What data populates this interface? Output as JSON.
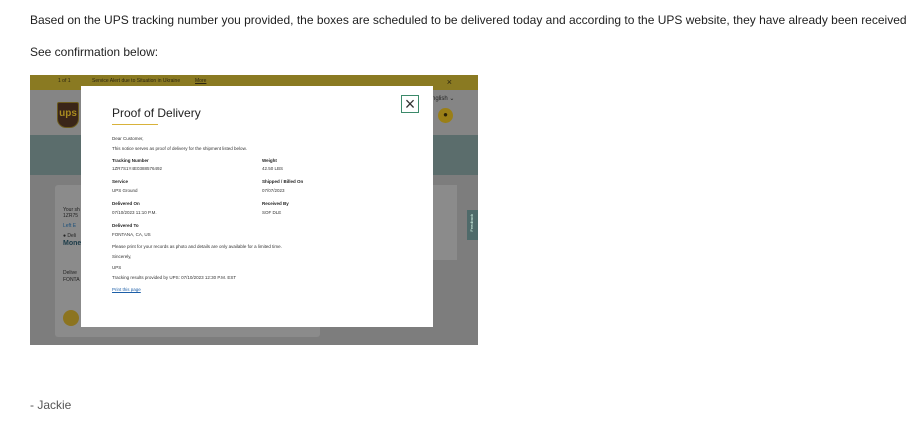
{
  "message": {
    "line1": "Based on the UPS tracking number you provided, the boxes are scheduled to be delivered today and according to the UPS website, they have already been received.",
    "line2": "See confirmation below:",
    "signature": "- Jackie"
  },
  "screenshot": {
    "alert": {
      "count": "1 of 1",
      "text": "Service Alert due to Situation in Ukraine",
      "more": "More",
      "close": "×"
    },
    "header": {
      "logo": "ups",
      "lang": "nglish ⌄"
    },
    "card": {
      "l1": "Your sh",
      "l2": "1ZR75",
      "l3": "Left E",
      "l4": "● Deli",
      "l5": "Mone",
      "l6": "Delive",
      "l7": "FONTA"
    },
    "feedback": "Feedback",
    "modal": {
      "title": "Proof of Delivery",
      "close": "×",
      "greeting": "Dear Customer,",
      "intro": "This notice serves as proof of delivery for the shipment listed below.",
      "tracking_label": "Tracking Number",
      "tracking_value": "1ZR7S1Y4E0388576492",
      "weight_label": "Weight",
      "weight_value": "42.50 LBS",
      "service_label": "Service",
      "service_value": "UPS Ground",
      "shipped_label": "Shipped / Billed On",
      "shipped_value": "07/07/2023",
      "delivered_on_label": "Delivered On",
      "delivered_on_value": "07/10/2023 11:10 P.M.",
      "received_label": "Received By",
      "received_value": "SOF DLE",
      "delivered_to_label": "Delivered To",
      "delivered_to_value": "FONTANA, CA, US",
      "notice": "Please print for your records as photo and details are only available for a limited time.",
      "sincerely": "Sincerely,",
      "company": "UPS",
      "provided": "Tracking results provided by UPS: 07/10/2023 12:30 P.M. EST",
      "print_link": "Print this page"
    }
  }
}
